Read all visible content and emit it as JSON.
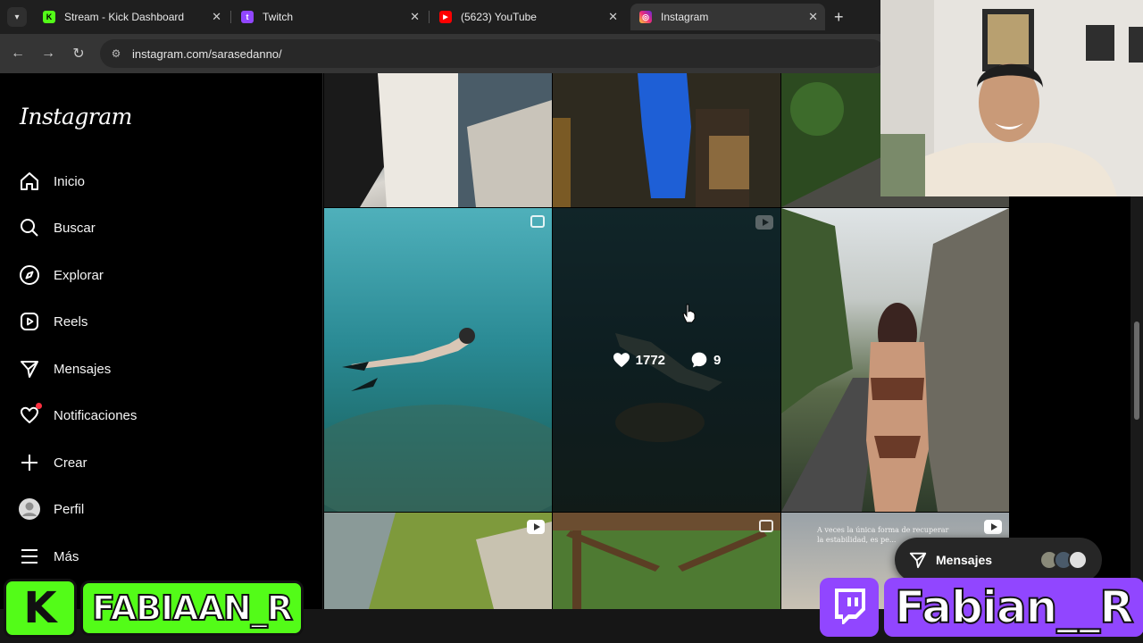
{
  "browser": {
    "tabs": [
      {
        "title": "Stream - Kick Dashboard",
        "favicon": "kick-icon",
        "color": "#53fc18"
      },
      {
        "title": "Twitch",
        "favicon": "twitch-icon",
        "color": "#9146ff"
      },
      {
        "title": "(5623) YouTube",
        "favicon": "youtube-icon",
        "color": "#ff0000"
      },
      {
        "title": "Instagram",
        "favicon": "instagram-icon",
        "color": "#e1306c"
      }
    ],
    "active_tab": 3,
    "url": "instagram.com/sarasedanno/"
  },
  "sidebar": {
    "logo": "Instagram",
    "items": [
      {
        "label": "Inicio",
        "icon": "home-icon"
      },
      {
        "label": "Buscar",
        "icon": "search-icon"
      },
      {
        "label": "Explorar",
        "icon": "compass-icon"
      },
      {
        "label": "Reels",
        "icon": "reels-icon"
      },
      {
        "label": "Mensajes",
        "icon": "send-icon"
      },
      {
        "label": "Notificaciones",
        "icon": "heart-icon"
      },
      {
        "label": "Crear",
        "icon": "plus-icon"
      },
      {
        "label": "Perfil",
        "icon": "profile-icon"
      },
      {
        "label": "Más",
        "icon": "menu-icon"
      }
    ]
  },
  "grid": {
    "hover_post": {
      "likes": "1772",
      "comments": "9"
    },
    "caption_fragment": "A veces la única forma de recuperar la estabilidad, es pe..."
  },
  "messages_pill": {
    "label": "Mensajes"
  },
  "stream": {
    "kick_name": "FABIAAN_R",
    "twitch_name": "Fabian__R"
  },
  "colors": {
    "instagram_bg": "#000000",
    "kick_green": "#53fc18",
    "twitch_purple": "#9146ff",
    "notification_dot": "#ff3040"
  }
}
